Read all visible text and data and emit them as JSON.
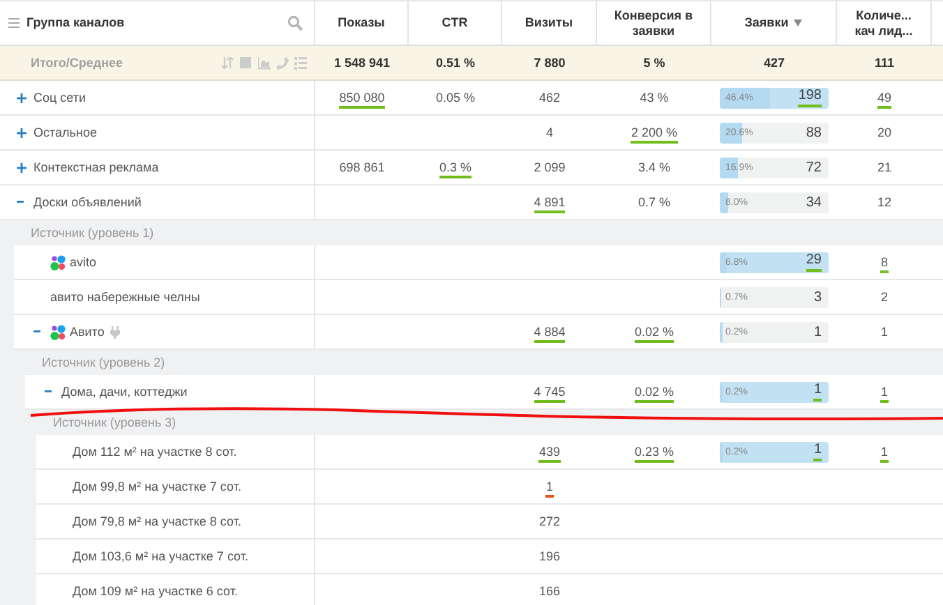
{
  "header": {
    "columns": [
      {
        "label": "Группа каналов",
        "kind": "name"
      },
      {
        "label": "Показы",
        "kind": "metric"
      },
      {
        "label": "CTR",
        "kind": "metric"
      },
      {
        "label": "Визиты",
        "kind": "metric"
      },
      {
        "label": "Конверсия в заявки",
        "kind": "metric"
      },
      {
        "label": "Заявки",
        "kind": "metric",
        "sorted": true
      },
      {
        "label": "Количе... кач лид...",
        "kind": "metric"
      }
    ]
  },
  "total": {
    "label": "Итого/Среднее",
    "values": [
      "1 548 941",
      "0.51 %",
      "7 880",
      "5 %",
      "427",
      "111"
    ]
  },
  "rows": [
    {
      "label": "Соц сети",
      "expanded": false,
      "cells": [
        {
          "text": "850 080",
          "color": "#72bd1e"
        },
        "0.05 %",
        "462",
        "43 %",
        {
          "share": "46.4%",
          "value": "198",
          "level": 0.464,
          "highlighted": true,
          "color": "#72bd1e"
        },
        {
          "text": "49",
          "color": "#72bd1e"
        }
      ]
    },
    {
      "label": "Остальное",
      "expanded": false,
      "cells": [
        null,
        null,
        "4",
        {
          "text": "2 200 %",
          "color": "#72bd1e"
        },
        {
          "share": "20.6%",
          "value": "88",
          "level": 0.206,
          "highlighted": false
        },
        "20"
      ]
    },
    {
      "label": "Контекстная реклама",
      "expanded": false,
      "cells": [
        "698 861",
        {
          "text": "0.3 %",
          "color": "#72bd1e"
        },
        "2 099",
        "3.4 %",
        {
          "share": "16.9%",
          "value": "72",
          "level": 0.169,
          "highlighted": false
        },
        "21"
      ]
    },
    {
      "label": "Доски объявлений",
      "expanded": true,
      "cells": [
        null,
        null,
        {
          "text": "4 891",
          "color": "#72bd1e"
        },
        "0.7 %",
        {
          "share": "8.0%",
          "value": "34",
          "level": 0.08,
          "highlighted": false
        },
        "12"
      ],
      "breakdown": {
        "title": "Источник (уровень 1)",
        "rows": [
          {
            "label": "avito",
            "logo": true,
            "cells": [
              null,
              null,
              null,
              null,
              {
                "share": "6.8%",
                "value": "29",
                "level": 0.068,
                "highlighted": true,
                "color": "#72bd1e"
              },
              {
                "text": "8",
                "color": "#72bd1e"
              }
            ]
          },
          {
            "label": "авито набережные челны",
            "cells": [
              null,
              null,
              null,
              null,
              {
                "share": "0.7%",
                "value": "3",
                "level": 0.007,
                "highlighted": false
              },
              "2"
            ]
          },
          {
            "label": "Авито",
            "expanded": true,
            "logo": true,
            "plugin": true,
            "cells": [
              null,
              null,
              {
                "text": "4 884",
                "color": "#72bd1e"
              },
              {
                "text": "0.02 %",
                "color": "#72bd1e"
              },
              {
                "share": "0.2%",
                "value": "1",
                "level": 0.02,
                "highlighted": false
              },
              "1"
            ],
            "breakdown": {
              "title": "Источник (уровень 2)",
              "rows": [
                {
                  "label": "Дома, дачи, коттеджи",
                  "expanded": true,
                  "cells": [
                    null,
                    null,
                    {
                      "text": "4 745",
                      "color": "#72bd1e"
                    },
                    {
                      "text": "0.02 %",
                      "color": "#72bd1e"
                    },
                    {
                      "share": "0.2%",
                      "value": "1",
                      "level": 0.02,
                      "highlighted": true,
                      "color": "#72bd1e"
                    },
                    {
                      "text": "1",
                      "color": "#72bd1e"
                    }
                  ],
                  "breakdown": {
                    "title": "Источник (уровень 3)",
                    "rows": [
                      {
                        "label": "Дом 112 м² на участке 8 сот.",
                        "cells": [
                          null,
                          null,
                          {
                            "text": "439",
                            "color": "#72bd1e"
                          },
                          {
                            "text": "0.23 %",
                            "color": "#72bd1e"
                          },
                          {
                            "share": "0.2%",
                            "value": "1",
                            "level": 0.02,
                            "highlighted": true,
                            "color": "#72bd1e"
                          },
                          {
                            "text": "1",
                            "color": "#72bd1e"
                          }
                        ]
                      },
                      {
                        "label": "Дом 99,8 м² на участке 7 сот.",
                        "cells": [
                          null,
                          null,
                          {
                            "text": "1",
                            "color": "#e2561a"
                          },
                          null,
                          null,
                          null
                        ]
                      },
                      {
                        "label": "Дом 79,8 м² на участке 8 сот.",
                        "cells": [
                          null,
                          null,
                          "272",
                          null,
                          null,
                          null
                        ]
                      },
                      {
                        "label": "Дом 103,6 м² на участке 7 сот.",
                        "cells": [
                          null,
                          null,
                          "196",
                          null,
                          null,
                          null
                        ]
                      },
                      {
                        "label": "Дом 109 м² на участке 6 сот.",
                        "cells": [
                          null,
                          null,
                          "166",
                          null,
                          null,
                          null
                        ]
                      }
                    ]
                  }
                }
              ]
            }
          }
        ]
      }
    }
  ]
}
